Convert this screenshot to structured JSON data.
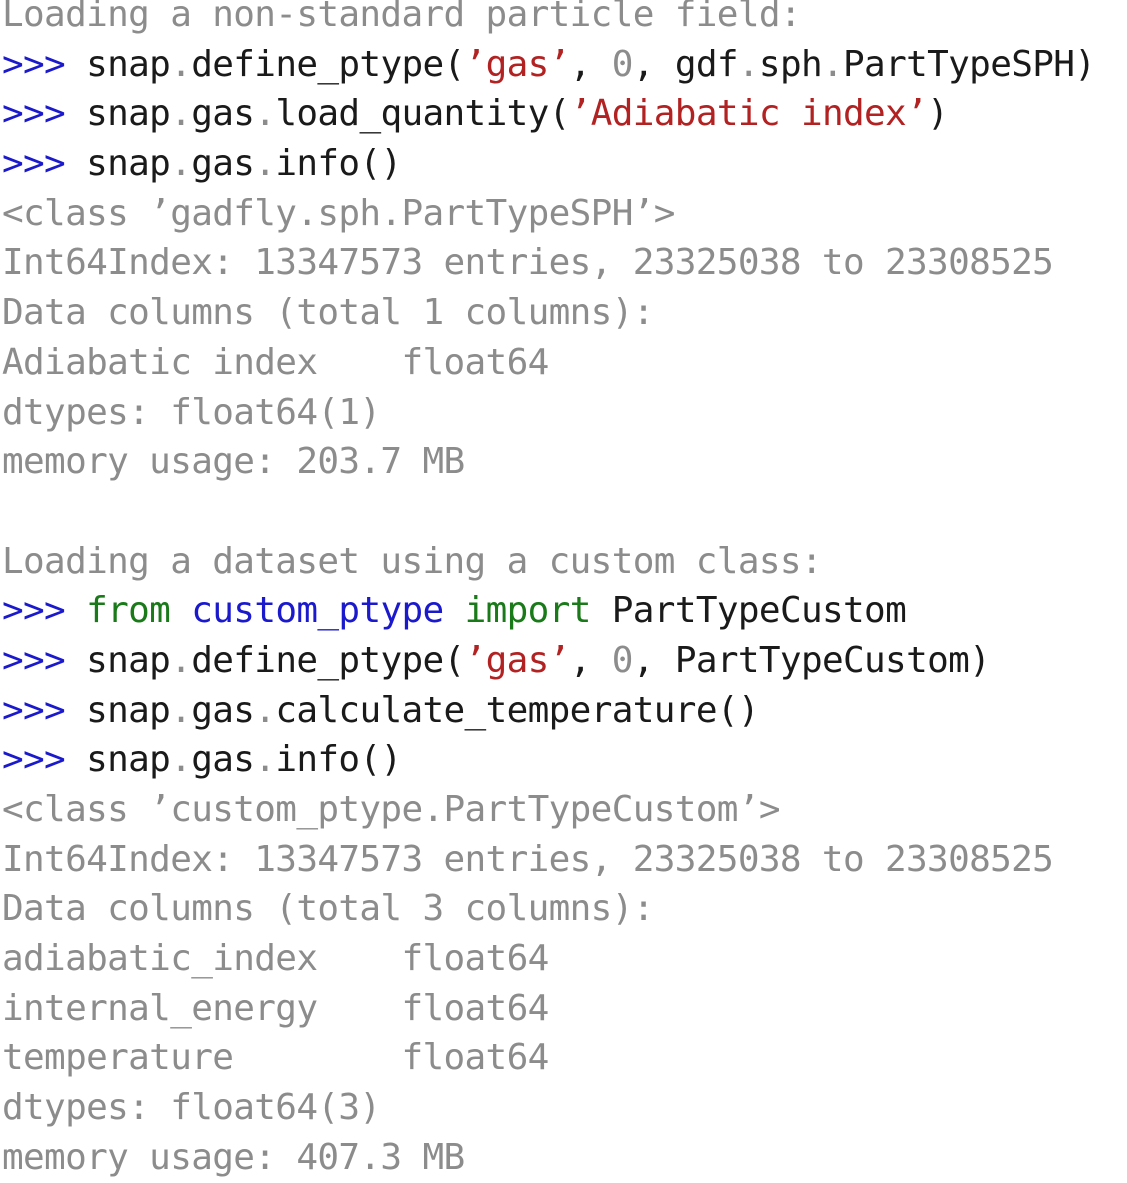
{
  "colors": {
    "default": "#1a1a1a",
    "output": "#8c8c8c",
    "prompt": "#1a1acc",
    "string": "#b22222",
    "keyword": "#1a7a1a",
    "module": "#1a1acc",
    "punct": "#8c8c8c"
  },
  "sections": [
    {
      "heading": "Loading a non-standard particle field:",
      "lines": [
        {
          "type": "code",
          "tokens": [
            {
              "t": ">>>",
              "c": "prompt"
            },
            {
              "t": " snap",
              "c": "default"
            },
            {
              "t": ".",
              "c": "punct"
            },
            {
              "t": "define_ptype(",
              "c": "default"
            },
            {
              "t": "’gas’",
              "c": "string"
            },
            {
              "t": ", ",
              "c": "default"
            },
            {
              "t": "0",
              "c": "punct"
            },
            {
              "t": ", gdf",
              "c": "default"
            },
            {
              "t": ".",
              "c": "punct"
            },
            {
              "t": "sph",
              "c": "default"
            },
            {
              "t": ".",
              "c": "punct"
            },
            {
              "t": "PartTypeSPH)",
              "c": "default"
            }
          ]
        },
        {
          "type": "code",
          "tokens": [
            {
              "t": ">>>",
              "c": "prompt"
            },
            {
              "t": " snap",
              "c": "default"
            },
            {
              "t": ".",
              "c": "punct"
            },
            {
              "t": "gas",
              "c": "default"
            },
            {
              "t": ".",
              "c": "punct"
            },
            {
              "t": "load_quantity(",
              "c": "default"
            },
            {
              "t": "’Adiabatic index’",
              "c": "string"
            },
            {
              "t": ")",
              "c": "default"
            }
          ]
        },
        {
          "type": "code",
          "tokens": [
            {
              "t": ">>>",
              "c": "prompt"
            },
            {
              "t": " snap",
              "c": "default"
            },
            {
              "t": ".",
              "c": "punct"
            },
            {
              "t": "gas",
              "c": "default"
            },
            {
              "t": ".",
              "c": "punct"
            },
            {
              "t": "info()",
              "c": "default"
            }
          ]
        },
        {
          "type": "output",
          "text": "<class ’gadfly.sph.PartTypeSPH’>"
        },
        {
          "type": "output",
          "text": "Int64Index: 13347573 entries, 23325038 to 23308525"
        },
        {
          "type": "output",
          "text": "Data columns (total 1 columns):"
        },
        {
          "type": "output",
          "text": "Adiabatic index    float64"
        },
        {
          "type": "output",
          "text": "dtypes: float64(1)"
        },
        {
          "type": "output",
          "text": "memory usage: 203.7 MB"
        }
      ]
    },
    {
      "heading": "Loading a dataset using a custom class:",
      "lines": [
        {
          "type": "code",
          "tokens": [
            {
              "t": ">>>",
              "c": "prompt"
            },
            {
              "t": " ",
              "c": "default"
            },
            {
              "t": "from",
              "c": "keyword"
            },
            {
              "t": " ",
              "c": "default"
            },
            {
              "t": "custom_ptype",
              "c": "module"
            },
            {
              "t": " ",
              "c": "default"
            },
            {
              "t": "import",
              "c": "keyword"
            },
            {
              "t": " PartTypeCustom",
              "c": "default"
            }
          ]
        },
        {
          "type": "code",
          "tokens": [
            {
              "t": ">>>",
              "c": "prompt"
            },
            {
              "t": " snap",
              "c": "default"
            },
            {
              "t": ".",
              "c": "punct"
            },
            {
              "t": "define_ptype(",
              "c": "default"
            },
            {
              "t": "’gas’",
              "c": "string"
            },
            {
              "t": ", ",
              "c": "default"
            },
            {
              "t": "0",
              "c": "punct"
            },
            {
              "t": ", PartTypeCustom)",
              "c": "default"
            }
          ]
        },
        {
          "type": "code",
          "tokens": [
            {
              "t": ">>>",
              "c": "prompt"
            },
            {
              "t": " snap",
              "c": "default"
            },
            {
              "t": ".",
              "c": "punct"
            },
            {
              "t": "gas",
              "c": "default"
            },
            {
              "t": ".",
              "c": "punct"
            },
            {
              "t": "calculate_temperature()",
              "c": "default"
            }
          ]
        },
        {
          "type": "code",
          "tokens": [
            {
              "t": ">>>",
              "c": "prompt"
            },
            {
              "t": " snap",
              "c": "default"
            },
            {
              "t": ".",
              "c": "punct"
            },
            {
              "t": "gas",
              "c": "default"
            },
            {
              "t": ".",
              "c": "punct"
            },
            {
              "t": "info()",
              "c": "default"
            }
          ]
        },
        {
          "type": "output",
          "text": "<class ’custom_ptype.PartTypeCustom’>"
        },
        {
          "type": "output",
          "text": "Int64Index: 13347573 entries, 23325038 to 23308525"
        },
        {
          "type": "output",
          "text": "Data columns (total 3 columns):"
        },
        {
          "type": "output",
          "text": "adiabatic_index    float64"
        },
        {
          "type": "output",
          "text": "internal_energy    float64"
        },
        {
          "type": "output",
          "text": "temperature        float64"
        },
        {
          "type": "output",
          "text": "dtypes: float64(3)"
        },
        {
          "type": "output",
          "text": "memory usage: 407.3 MB"
        }
      ]
    }
  ]
}
